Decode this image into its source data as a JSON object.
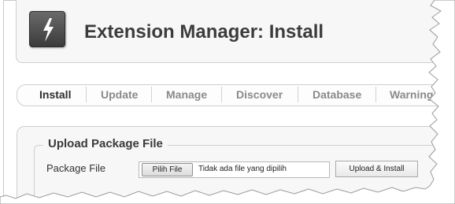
{
  "header": {
    "title": "Extension Manager: Install",
    "icon": "lightning-bolt-icon"
  },
  "tabs": [
    {
      "label": "Install",
      "active": true
    },
    {
      "label": "Update",
      "active": false
    },
    {
      "label": "Manage",
      "active": false
    },
    {
      "label": "Discover",
      "active": false
    },
    {
      "label": "Database",
      "active": false
    },
    {
      "label": "Warnings",
      "active": false
    }
  ],
  "upload": {
    "legend": "Upload Package File",
    "field_label": "Package File",
    "choose_file_label": "Pilih File",
    "file_status": "Tidak ada file yang dipilih",
    "submit_label": "Upload & Install"
  }
}
